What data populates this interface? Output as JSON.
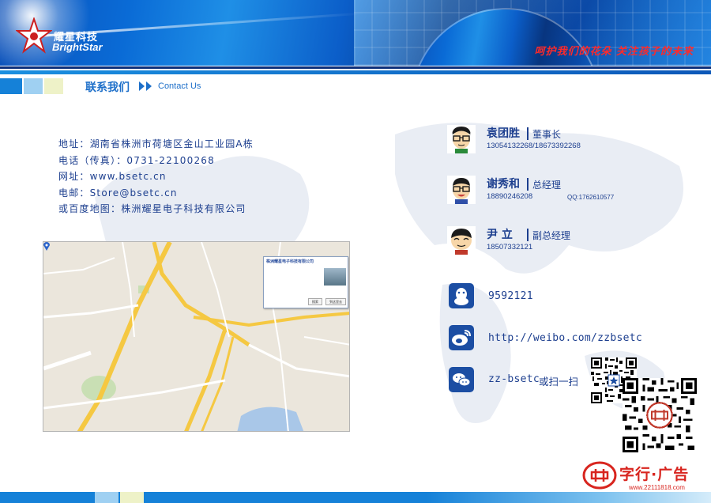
{
  "header": {
    "logo_cn": "耀星科技",
    "logo_en": "BrightStar",
    "slogan": "呵护我们的花朵  关注孩子的未来"
  },
  "section": {
    "title": "联系我们",
    "title_en": "Contact Us"
  },
  "contact": [
    "地址：湖南省株洲市荷塘区金山工业园A栋",
    "电话（传真）：0731-22100268",
    "网址：www.bsetc.cn",
    "电邮：Store@bsetc.cn",
    "或百度地图：株洲耀星电子科技有限公司"
  ],
  "map": {
    "popup_title": "株洲耀星电子科技有限公司",
    "popup_btn_search": "搜索",
    "popup_btn_nav": "到这里去"
  },
  "people": [
    {
      "name": "袁团胜",
      "title": "董事长",
      "phone": "13054132268/18673392268",
      "qq": ""
    },
    {
      "name": "谢秀和",
      "title": "总经理",
      "phone": "18890246208",
      "qq": "QQ:1762610577"
    },
    {
      "name": "尹  立",
      "title": "副总经理",
      "phone": "18507332121",
      "qq": ""
    }
  ],
  "social": {
    "qq": "9592121",
    "weibo": "http://weibo.com/zzbsetc",
    "wechat": "zz-bsetc",
    "wechat_extra": "或扫一扫"
  },
  "watermark": {
    "text": "字行·广告",
    "url": "www.22111818.com"
  },
  "colors": {
    "brand_blue": "#1d3f8f",
    "accent_blue": "#1581d8",
    "slogan_red": "#ff2a2a"
  }
}
